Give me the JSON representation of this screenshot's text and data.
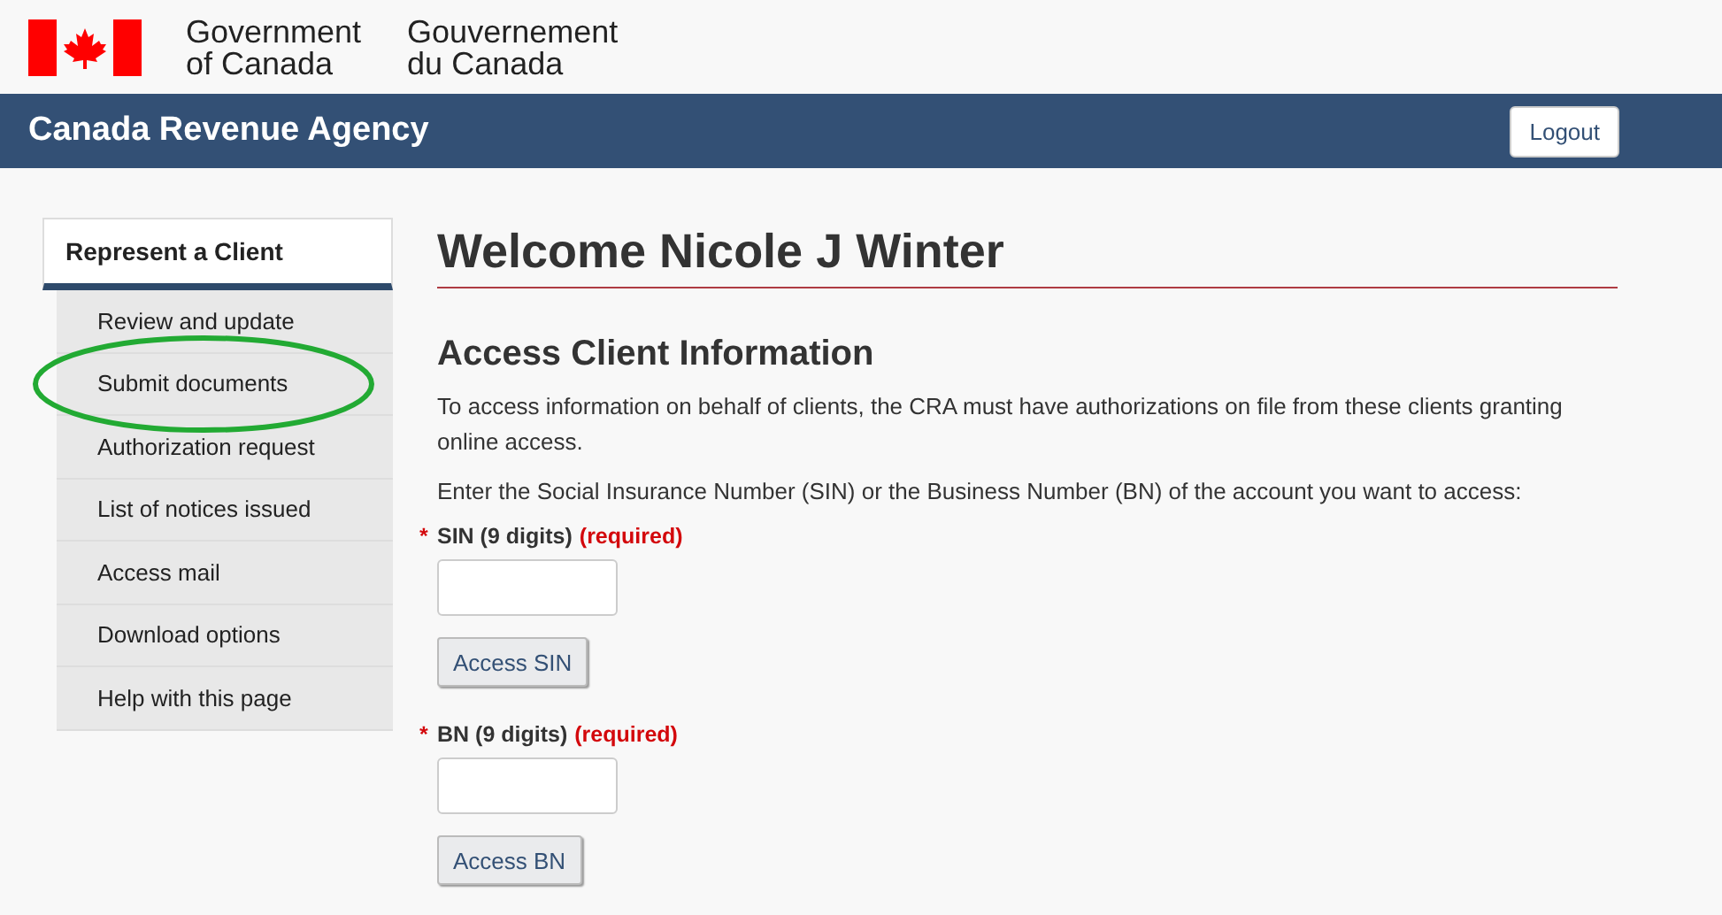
{
  "header": {
    "name_en": [
      "Government",
      "of Canada"
    ],
    "name_fr": [
      "Gouvernement",
      "du Canada"
    ]
  },
  "banner": {
    "title": "Canada Revenue Agency",
    "logout": "Logout"
  },
  "sidebar": {
    "heading": "Represent a Client",
    "items": [
      {
        "label": "Review and update",
        "circled": false
      },
      {
        "label": "Submit documents",
        "circled": true
      },
      {
        "label": "Authorization request",
        "circled": false
      },
      {
        "label": "List of notices issued",
        "circled": false
      },
      {
        "label": "Access mail",
        "circled": false
      },
      {
        "label": "Download options",
        "circled": false
      },
      {
        "label": "Help with this page",
        "circled": false
      }
    ]
  },
  "main": {
    "title": "Welcome Nicole J Winter",
    "section_title": "Access Client Information",
    "paragraphs": [
      "To access information on behalf of clients, the CRA must have authorizations on file from these clients granting online access.",
      "Enter the Social Insurance Number (SIN) or the Business Number (BN) of the account you want to access:"
    ],
    "fields": [
      {
        "asterisk": "*",
        "label": "SIN (9 digits)",
        "required": "(required)",
        "button": "Access SIN"
      },
      {
        "asterisk": "*",
        "label": "BN (9 digits)",
        "required": "(required)",
        "button": "Access BN"
      }
    ]
  }
}
